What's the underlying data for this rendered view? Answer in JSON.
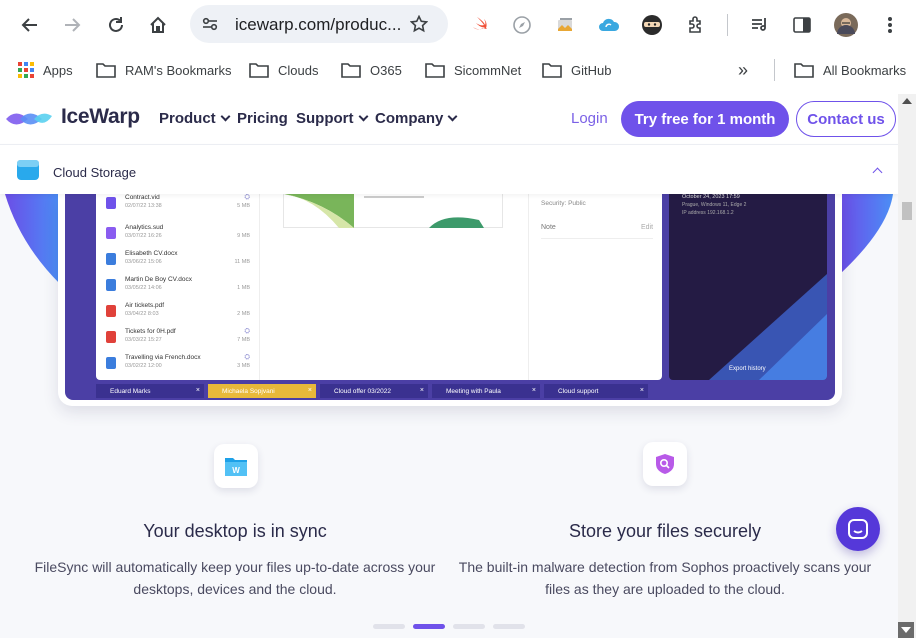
{
  "browser": {
    "url": "icewarp.com/produc...",
    "buttons": {
      "back": "back-icon",
      "forward": "forward-icon",
      "reload": "reload-icon",
      "home": "home-icon"
    }
  },
  "bookmarks": {
    "apps": "Apps",
    "items": [
      "RAM's Bookmarks",
      "Clouds",
      "O365",
      "SicommNet",
      "GitHub"
    ],
    "more": "»",
    "all": "All Bookmarks"
  },
  "site": {
    "brand": "IceWarp",
    "nav": [
      "Product",
      "Pricing",
      "Support",
      "Company"
    ],
    "login": "Login",
    "try_button": "Try free for 1 month",
    "contact_button": "Contact us",
    "brand_color": "#6f52ea"
  },
  "subbar": {
    "title": "Cloud Storage"
  },
  "mock": {
    "files": [
      {
        "name": "Contract.vid",
        "date": "02/07/22 13:38",
        "size": "5 MB",
        "color": "#6f52ea",
        "shared": true
      },
      {
        "name": "Analytics.sud",
        "date": "03/07/22 16:26",
        "size": "9 MB",
        "color": "#8a5cf0",
        "shared": false
      },
      {
        "name": "Elisabeth CV.docx",
        "date": "03/06/22 15:06",
        "size": "11 MB",
        "color": "#3b7ddd",
        "shared": false
      },
      {
        "name": "Martin De Boy CV.docx",
        "date": "03/05/22 14:06",
        "size": "1 MB",
        "color": "#3b7ddd",
        "shared": false
      },
      {
        "name": "Air tickets.pdf",
        "date": "03/04/22 8:03",
        "size": "2 MB",
        "color": "#e0413a",
        "shared": false
      },
      {
        "name": "Tickets for 0H.pdf",
        "date": "03/03/22 15:27",
        "size": "7 MB",
        "color": "#e0413a",
        "shared": true
      },
      {
        "name": "Travelling via French.docx",
        "date": "03/02/22 12:00",
        "size": "3 MB",
        "color": "#3b7ddd",
        "shared": true
      }
    ],
    "details": {
      "security": "Security: Public",
      "note": "Note",
      "edit": "Edit"
    },
    "dark": {
      "date": "October 24, 2023 17:59",
      "device": "Prague, Windows 11, Edge 2",
      "ip": "IP address 192.168.1.2",
      "export": "Export history"
    },
    "tabs": [
      "Eduard Marks",
      "Michaela Sopjvani",
      "Cloud offer 03/2022",
      "Meeting with Paula",
      "Cloud support"
    ]
  },
  "features": [
    {
      "title": "Your desktop is in sync",
      "desc": "FileSync will automatically keep your files up-to-date across your desktops, devices and the cloud.",
      "icon": "filesync-folder-icon"
    },
    {
      "title": "Store your files securely",
      "desc": "The built-in malware detection from Sophos proactively scans your files as they are uploaded to the cloud.",
      "icon": "shield-search-icon"
    }
  ],
  "carousel": {
    "pages": 4,
    "active": 2
  }
}
